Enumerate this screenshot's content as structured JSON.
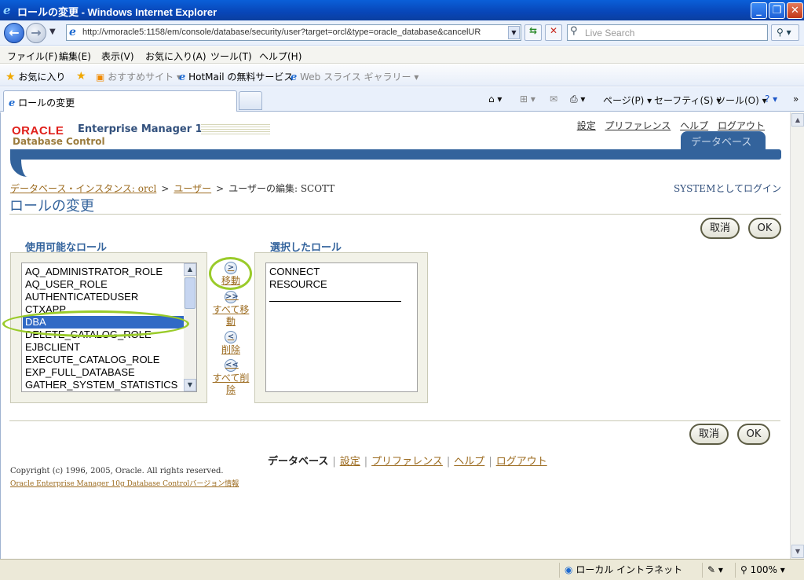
{
  "window": {
    "title": "ロールの変更 - Windows Internet Explorer"
  },
  "browser": {
    "url": "http://vmoracle5:1158/em/console/database/security/user?target=orcl&type=oracle_database&cancelUR",
    "search_placeholder": "Live Search",
    "menu": [
      "ファイル(F)",
      "編集(E)",
      "表示(V)",
      "お気に入り(A)",
      "ツール(T)",
      "ヘルプ(H)"
    ],
    "favorites": {
      "label": "お気に入り",
      "items": [
        "おすすめサイト ▾",
        "HotMail の無料サービス",
        "Web スライス ギャラリー ▾"
      ]
    },
    "tab_title": "ロールの変更",
    "commands": {
      "page": "ページ(P) ▾",
      "safety": "セーフティ(S) ▾",
      "tools": "ツール(O) ▾"
    }
  },
  "em": {
    "logo": "ORACLE",
    "product": "Enterprise Manager 10",
    "product_g": "g",
    "subtitle": "Database Control",
    "top_links": [
      "設定",
      "プリファレンス",
      "ヘルプ",
      "ログアウト"
    ],
    "active_tab": "データベース"
  },
  "breadcrumb": {
    "instance": "データベース・インスタンス: orcl",
    "users": "ユーザー",
    "current": "ユーザーの編集: SCOTT",
    "sep": ">"
  },
  "login_as": "SYSTEMとしてログイン",
  "page_title": "ロールの変更",
  "buttons": {
    "cancel": "取消",
    "ok": "OK"
  },
  "available_roles": {
    "label": "使用可能なロール",
    "items": [
      "AQ_ADMINISTRATOR_ROLE",
      "AQ_USER_ROLE",
      "AUTHENTICATEDUSER",
      "CTXAPP",
      "DBA",
      "DELETE_CATALOG_ROLE",
      "EJBCLIENT",
      "EXECUTE_CATALOG_ROLE",
      "EXP_FULL_DATABASE",
      "GATHER_SYSTEM_STATISTICS"
    ],
    "selected": "DBA"
  },
  "shuttle": {
    "move": "移動",
    "move_all": "すべて移動",
    "remove": "削除",
    "remove_all": "すべて削除",
    "move_icon": ">",
    "move_all_icon": ">>",
    "remove_icon": "<",
    "remove_all_icon": "<<"
  },
  "selected_roles": {
    "label": "選択したロール",
    "items": [
      "CONNECT",
      "RESOURCE"
    ]
  },
  "footer": {
    "links": [
      "データベース",
      "設定",
      "プリファレンス",
      "ヘルプ",
      "ログアウト"
    ],
    "copyright": "Copyright (c) 1996, 2005, Oracle. All rights reserved.",
    "version": "Oracle Enterprise Manager 10g Database Controlバージョン情報"
  },
  "status": {
    "zone": "ローカル イントラネット",
    "zoom": "100%"
  }
}
